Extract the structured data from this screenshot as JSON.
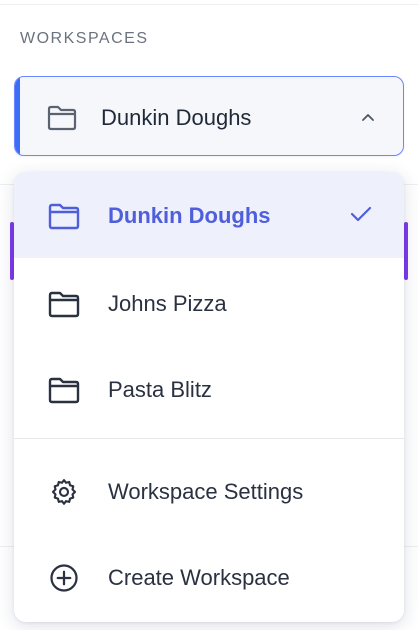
{
  "sidebar": {
    "section_label": "WORKSPACES",
    "current_workspace": "Dunkin Doughs"
  },
  "dropdown": {
    "workspaces": [
      {
        "label": "Dunkin Doughs",
        "selected": true,
        "icon": "folder-icon"
      },
      {
        "label": "Johns Pizza",
        "selected": false,
        "icon": "folder-icon"
      },
      {
        "label": "Pasta Blitz",
        "selected": false,
        "icon": "folder-icon"
      }
    ],
    "actions": [
      {
        "label": "Workspace Settings",
        "icon": "gear-icon"
      },
      {
        "label": "Create Workspace",
        "icon": "plus-circle-icon"
      }
    ]
  },
  "colors": {
    "accent": "#3b6df6",
    "selected_text": "#4f5fdc",
    "selected_bg": "#eef0fc",
    "text": "#2a3140"
  }
}
